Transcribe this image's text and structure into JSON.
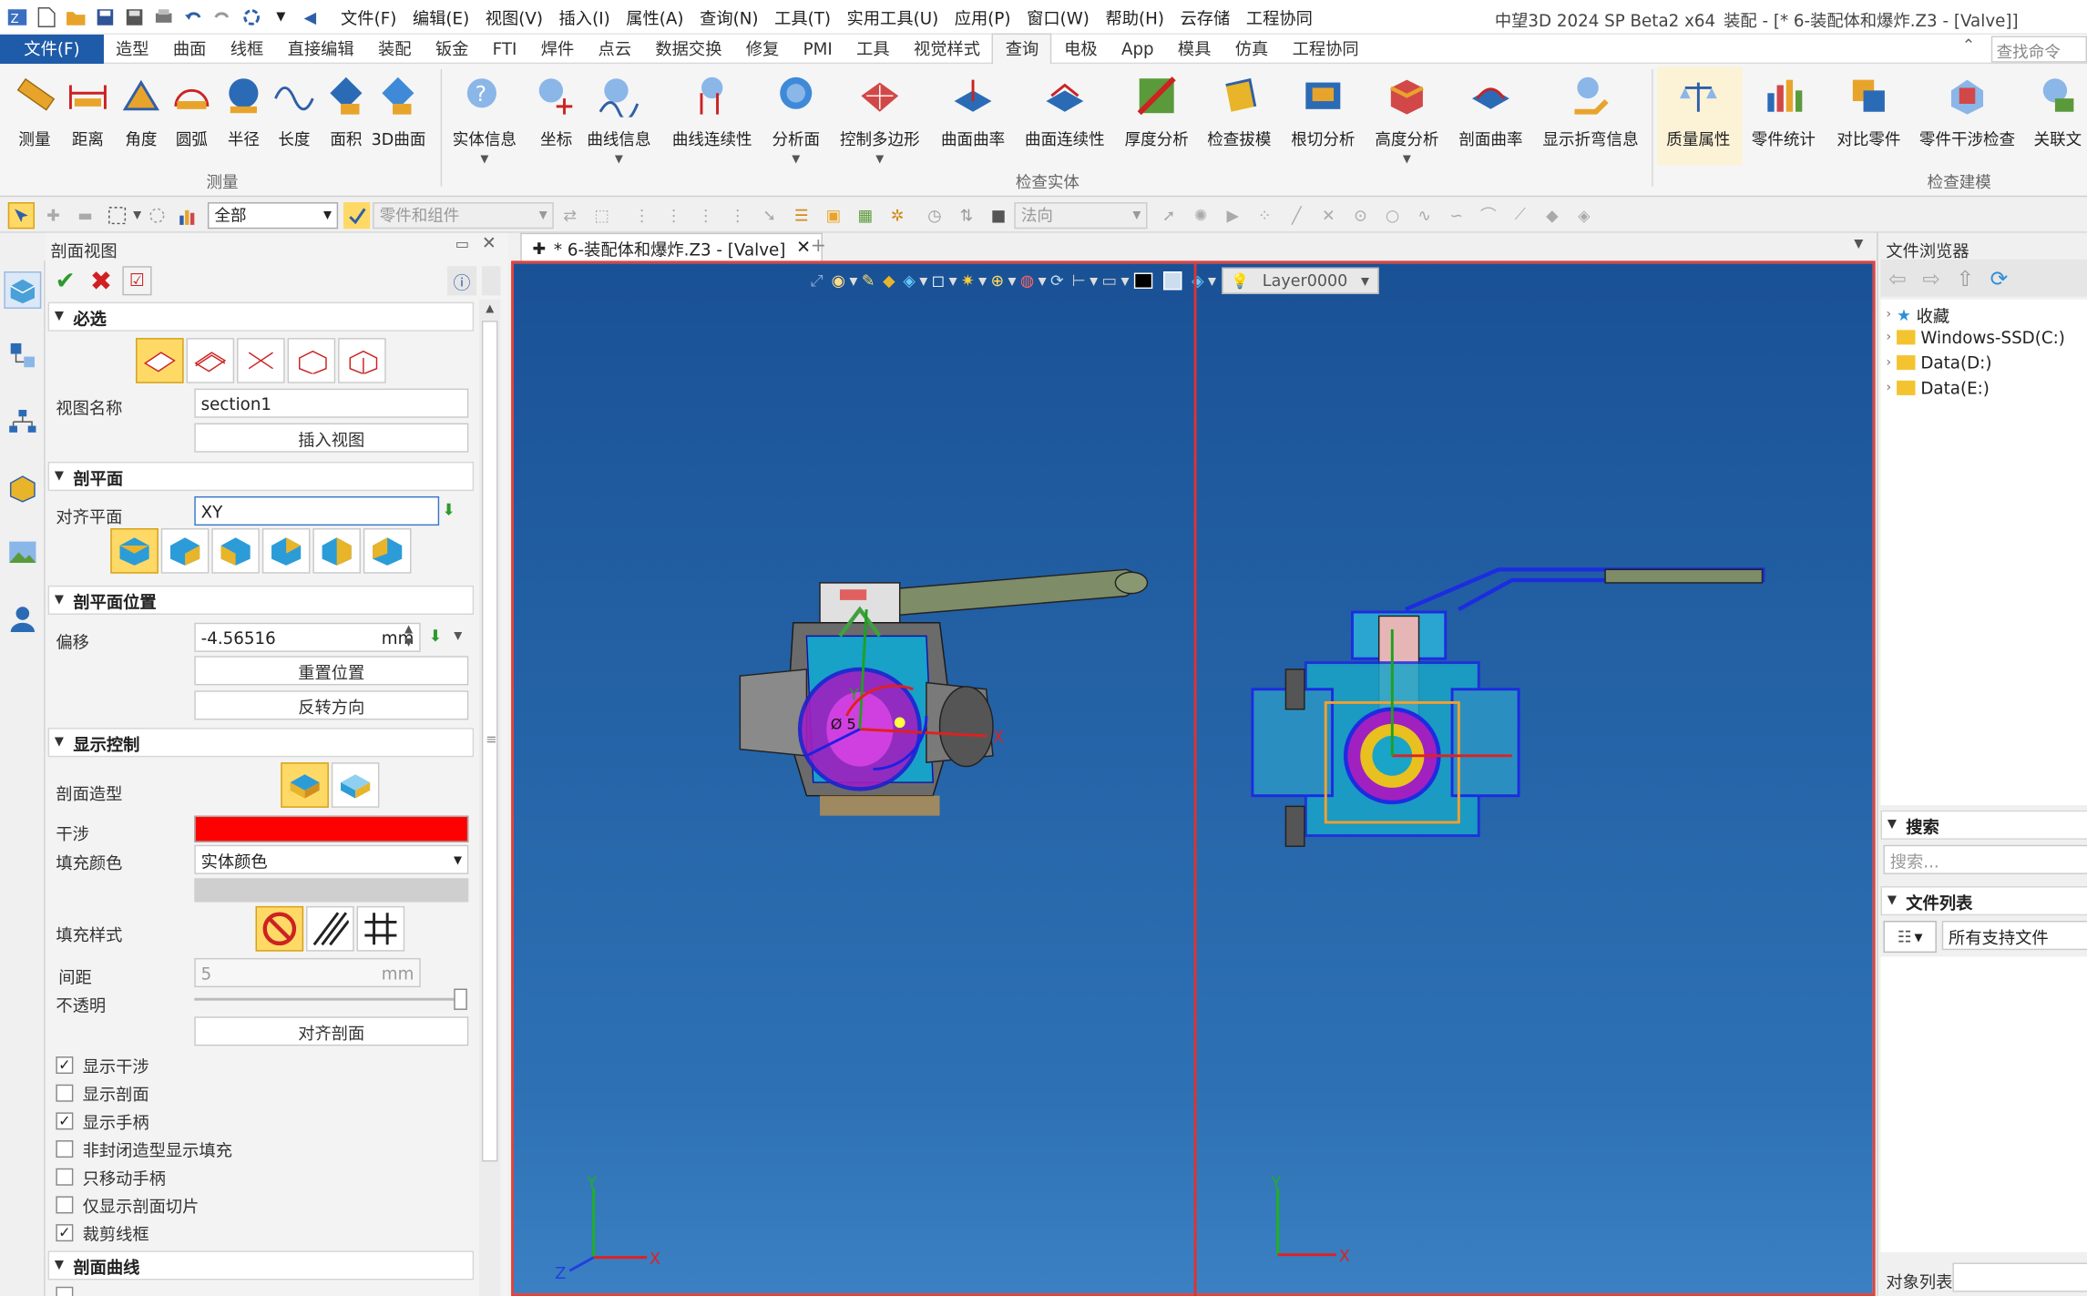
{
  "titlebar": {
    "menus": [
      "文件(F)",
      "编辑(E)",
      "视图(V)",
      "插入(I)",
      "属性(A)",
      "查询(N)",
      "工具(T)",
      "实用工具(U)",
      "应用(P)",
      "窗口(W)",
      "帮助(H)",
      "云存储",
      "工程协同"
    ],
    "app_title": "中望3D 2024 SP Beta2 x64",
    "doc_title": "装配 - [* 6-装配体和爆炸.Z3 - [Valve]]"
  },
  "ribbon_tabs": [
    "文件(F)",
    "造型",
    "曲面",
    "线框",
    "直接编辑",
    "装配",
    "钣金",
    "FTI",
    "焊件",
    "点云",
    "数据交换",
    "修复",
    "PMI",
    "工具",
    "视觉样式",
    "查询",
    "电极",
    "App",
    "模具",
    "仿真",
    "工程协同"
  ],
  "active_tab": "查询",
  "search_placeholder": "查找命令",
  "ribbon": {
    "measure": [
      "测量",
      "距离",
      "角度",
      "圆弧",
      "半径",
      "长度",
      "面积",
      "3D曲面"
    ],
    "measure_group": "测量",
    "inspect": [
      "实体信息",
      "坐标",
      "曲线信息",
      "曲线连续性",
      "分析面",
      "控制多边形",
      "曲面曲率",
      "曲面连续性",
      "厚度分析",
      "检查拔模",
      "根切分析",
      "高度分析",
      "剖面曲率",
      "显示折弯信息"
    ],
    "inspect_group": "检查实体",
    "model": [
      "质量属性",
      "零件统计",
      "对比零件",
      "零件干涉检查",
      "关联文"
    ],
    "model_group": "检查建模"
  },
  "toolbar": {
    "filter_value": "全部",
    "parts_value": "零件和组件",
    "normal_value": "法向"
  },
  "panel": {
    "title": "剖面视图",
    "required": "必选",
    "view_name_label": "视图名称",
    "view_name_value": "section1",
    "insert_view": "插入视图",
    "section_plane": "剖平面",
    "align_plane_label": "对齐平面",
    "align_plane_value": "XY",
    "plane_position": "剖平面位置",
    "offset_label": "偏移",
    "offset_value": "-4.56516",
    "unit": "mm",
    "reset_position": "重置位置",
    "reverse_direction": "反转方向",
    "display_control": "显示控制",
    "section_shape_label": "剖面造型",
    "interference_label": "干涉",
    "interference_color": "#ff0000",
    "fill_color_label": "填充颜色",
    "fill_color_value": "实体颜色",
    "fill_style_label": "填充样式",
    "spacing_label": "间距",
    "spacing_value": "5",
    "opacity_label": "不透明",
    "align_section": "对齐剖面",
    "checks": [
      {
        "label": "显示干涉",
        "checked": true
      },
      {
        "label": "显示剖面",
        "checked": false
      },
      {
        "label": "显示手柄",
        "checked": true
      },
      {
        "label": "非封闭造型显示填充",
        "checked": false
      },
      {
        "label": "只移动手柄",
        "checked": false
      },
      {
        "label": "仅显示剖面切片",
        "checked": false
      },
      {
        "label": "裁剪线框",
        "checked": true
      }
    ],
    "section_curve": "剖面曲线"
  },
  "document_tab": "* 6-装配体和爆炸.Z3 - [Valve]",
  "layer_value": "Layer0000",
  "viewport": {
    "dim_text": "Ø 5",
    "axis_x": "X",
    "axis_y": "Y",
    "axis_z": "Z"
  },
  "file_browser": {
    "title": "文件浏览器",
    "tree": [
      "收藏",
      "Windows-SSD(C:)",
      "Data(D:)",
      "Data(E:)"
    ],
    "search_title": "搜索",
    "search_placeholder": "搜索...",
    "file_list_title": "文件列表",
    "file_filter": "所有支持文件",
    "object_list": "对象列表"
  }
}
